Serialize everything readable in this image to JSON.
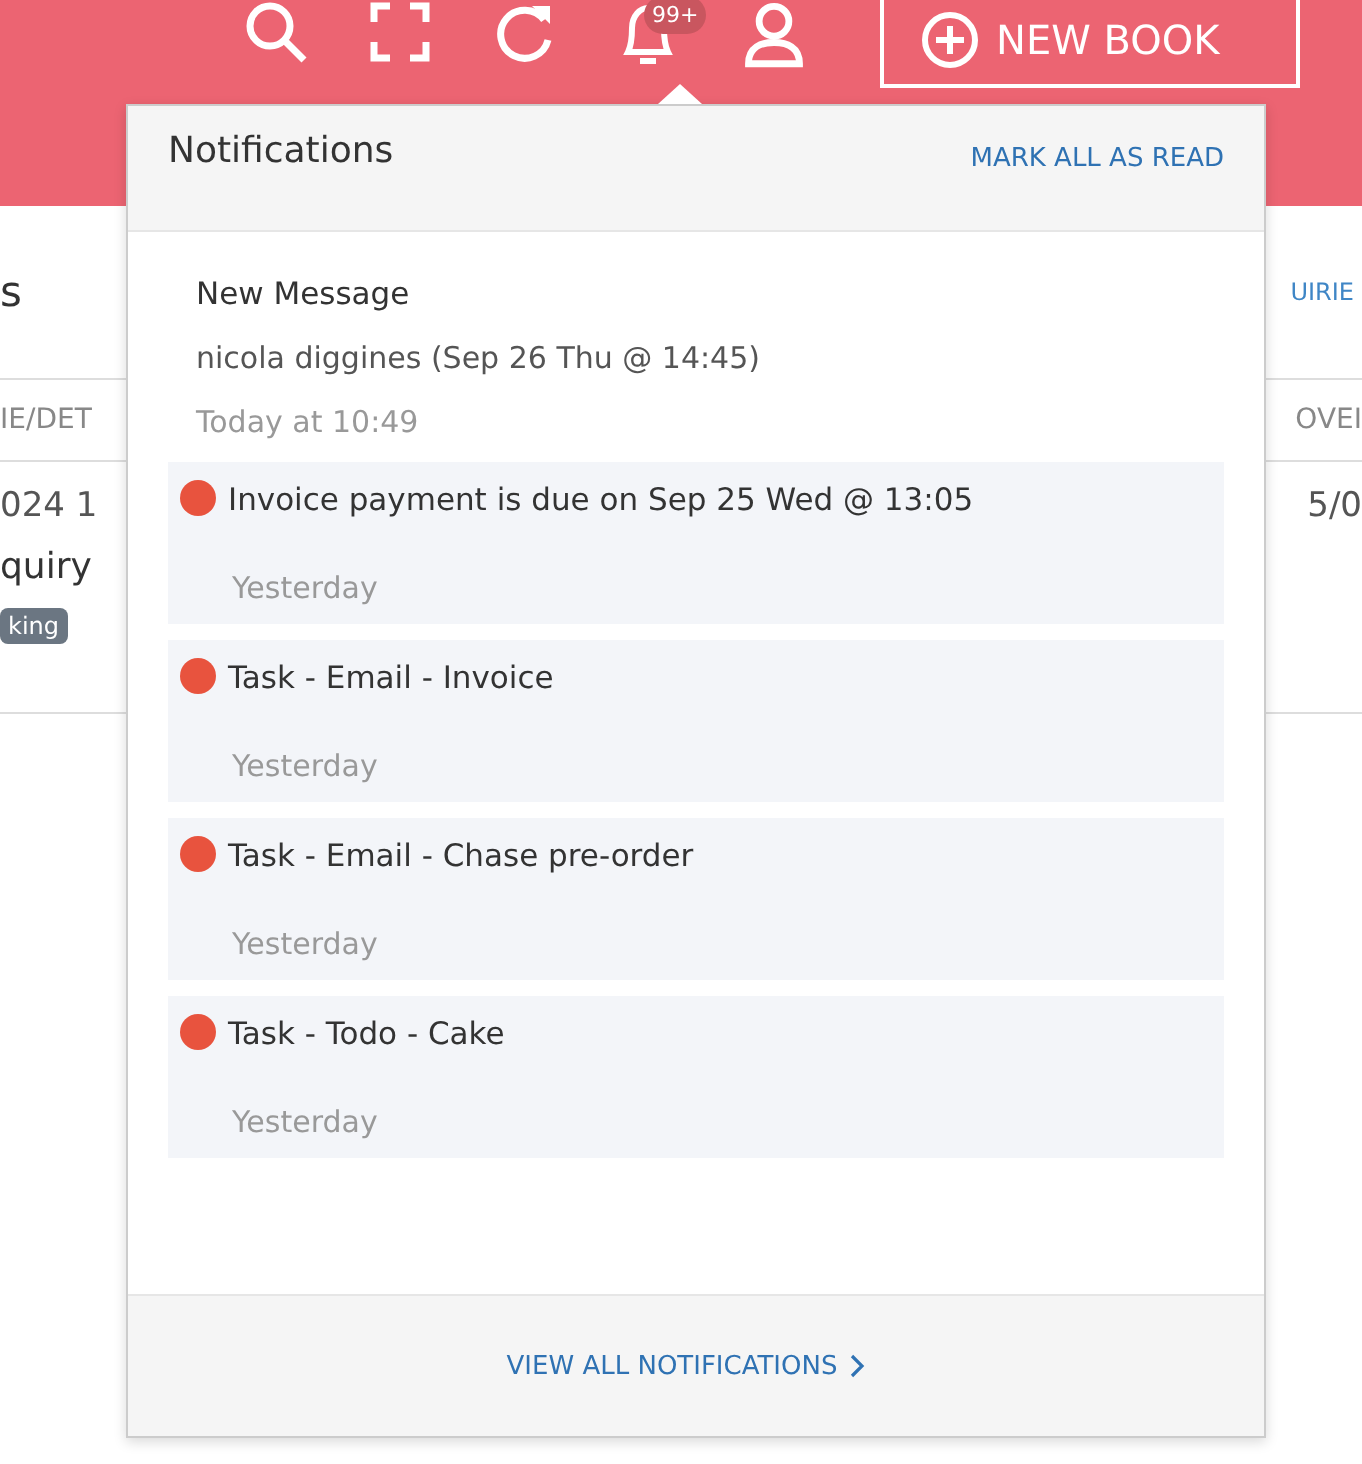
{
  "header": {
    "notification_badge": "99+",
    "new_button": "NEW BOOK"
  },
  "page": {
    "title": "s",
    "link": "UIRIE",
    "columns": [
      "IE/DET",
      "OVEI"
    ],
    "row": {
      "cell_1": "024 1",
      "cell_2": "5/0",
      "type": "quiry",
      "badge": "king"
    }
  },
  "notifications": {
    "title": "Notifications",
    "mark_all": "MARK ALL AS READ",
    "items": [
      {
        "title": "New Message",
        "detail": "nicola diggines (Sep 26 Thu @ 14:45)",
        "time": "Today at 10:49",
        "unread": false
      },
      {
        "title": "Invoice payment is due on Sep 25 Wed @ 13:05",
        "time": "Yesterday",
        "unread": true
      },
      {
        "title": "Task - Email - Invoice",
        "time": "Yesterday",
        "unread": true
      },
      {
        "title": "Task - Email - Chase pre-order",
        "time": "Yesterday",
        "unread": true
      },
      {
        "title": "Task - Todo - Cake",
        "time": "Yesterday",
        "unread": true
      }
    ],
    "view_all": "VIEW ALL NOTIFICATIONS"
  }
}
